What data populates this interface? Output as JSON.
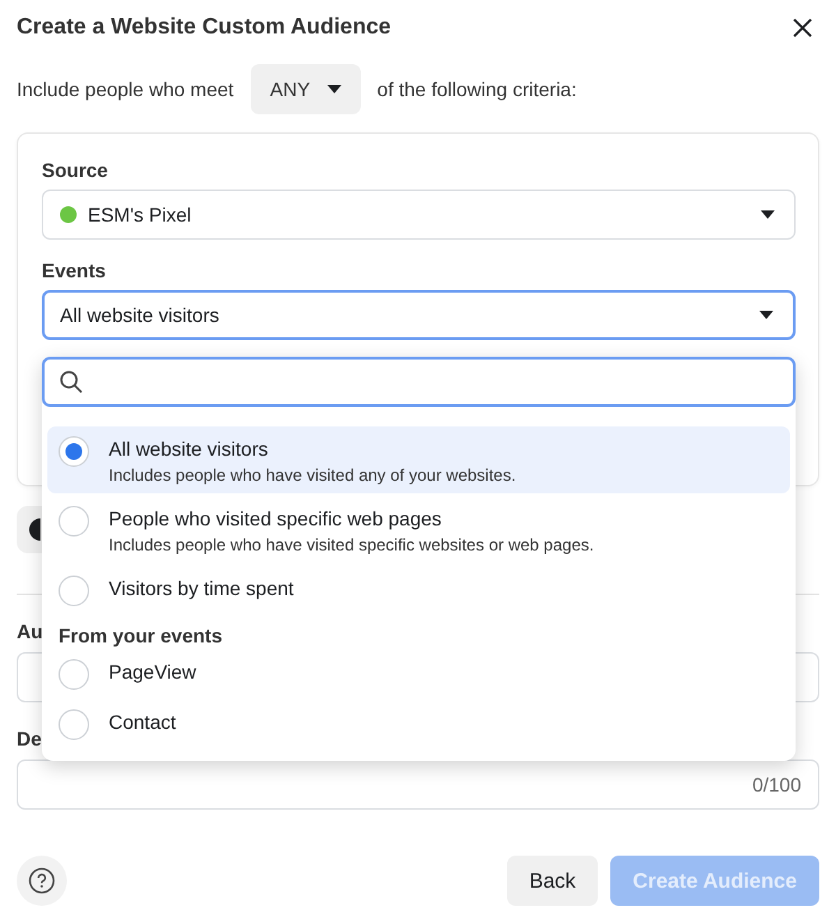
{
  "dialog": {
    "title": "Create a Website Custom Audience"
  },
  "criteria": {
    "prefix": "Include people who meet",
    "match": "ANY",
    "suffix": "of the following criteria:"
  },
  "rule_card": {
    "source_label": "Source",
    "source": {
      "value": "ESM's Pixel",
      "color": "#6cc644"
    },
    "events_label": "Events",
    "events": {
      "value": "All website visitors",
      "focused": true
    }
  },
  "audience_name": {
    "label": "Au"
  },
  "description": {
    "label": "De",
    "counter": "0/100"
  },
  "dropdown": {
    "items": [
      {
        "kind": "option",
        "label": "All website visitors",
        "description": "Includes people who have visited any of your websites.",
        "selected": true
      },
      {
        "kind": "option",
        "label": "People who visited specific web pages",
        "description": "Includes people who have visited specific websites or web pages.",
        "selected": false
      },
      {
        "kind": "option",
        "label": "Visitors by time spent",
        "selected": false
      },
      {
        "kind": "header",
        "label": "From your events"
      },
      {
        "kind": "option",
        "label": "PageView",
        "selected": false
      },
      {
        "kind": "option",
        "label": "Contact",
        "selected": false
      }
    ]
  },
  "footer": {
    "buttons": [
      {
        "label": "Back"
      },
      {
        "label": "Create Audience",
        "disabled": true
      }
    ]
  }
}
